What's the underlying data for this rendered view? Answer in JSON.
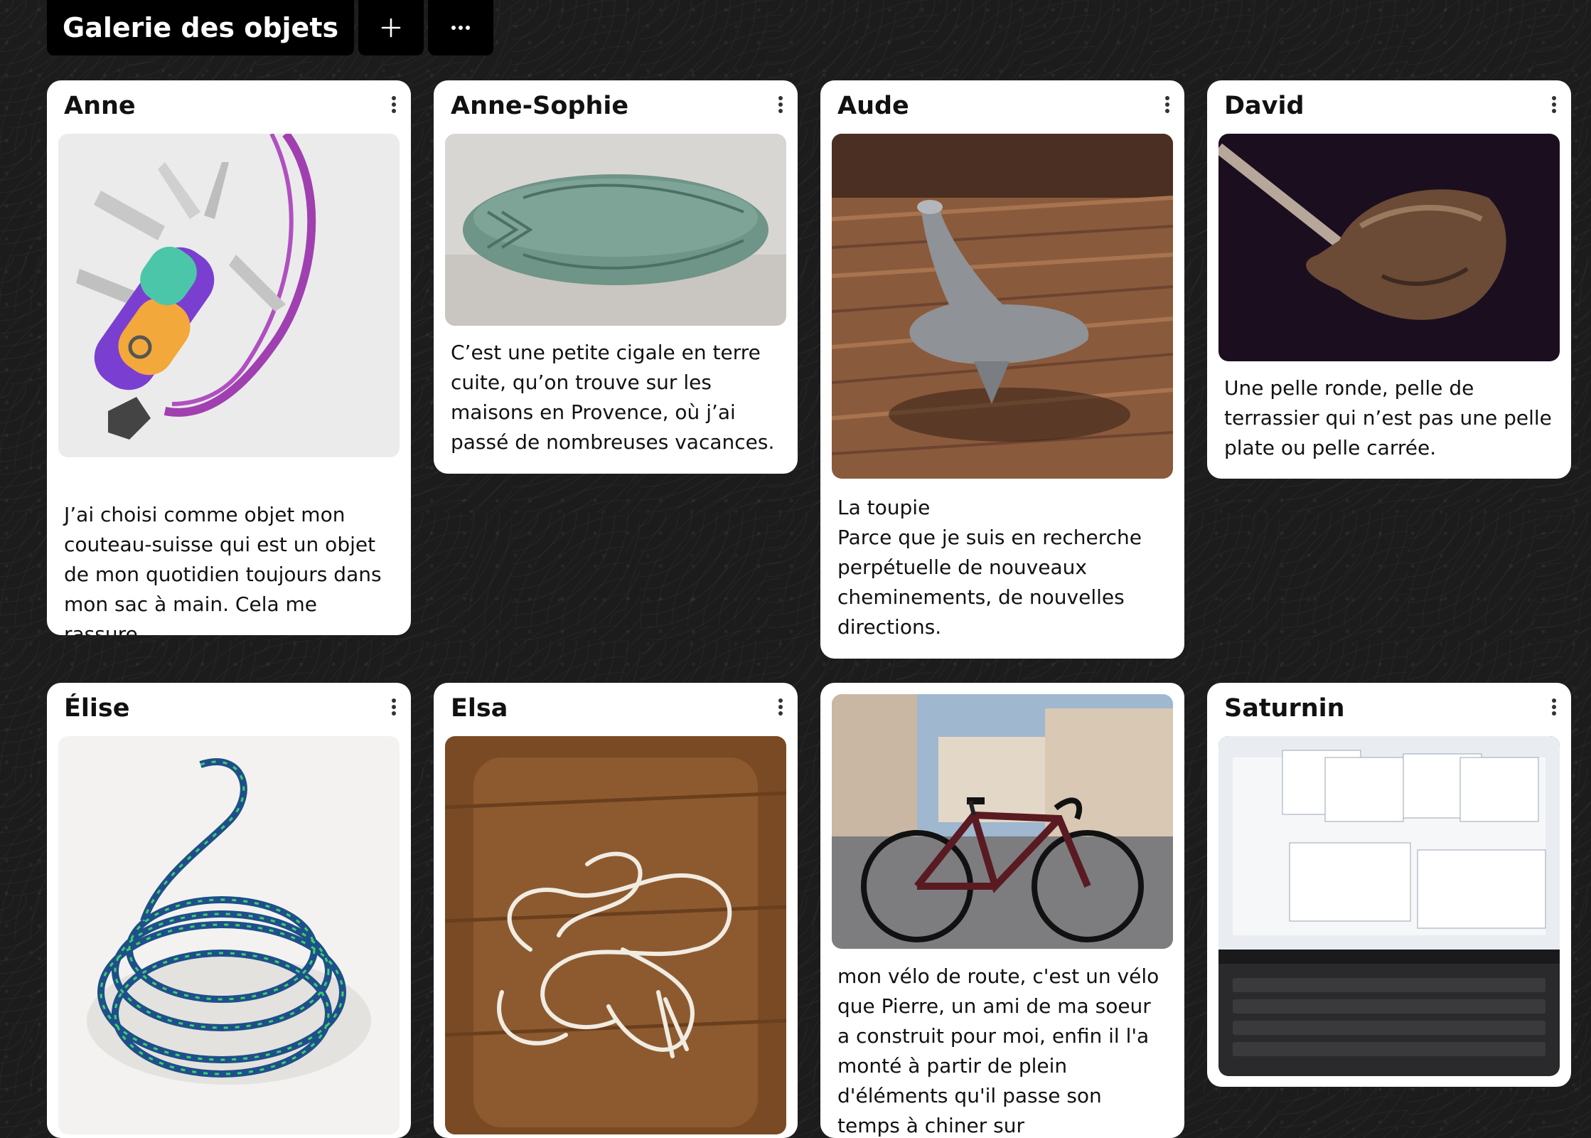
{
  "app": {
    "title": "Galerie des objets",
    "add_label": "+",
    "more_label": "···"
  },
  "cards": [
    {
      "author": "Anne",
      "description": "J’ai choisi comme objet mon couteau-suisse qui est un objet de mon quotidien toujours dans mon sac à main. Cela me rassure.",
      "image": "swiss-army-knife-photo"
    },
    {
      "author": "Anne-Sophie",
      "description": "C’est une petite cigale en terre cuite, qu’on trouve sur les maisons en Provence, où j’ai passé de nombreuses vacances.",
      "image": "ceramic-cicada-photo"
    },
    {
      "author": "Aude",
      "description": "La toupie\nParce que je suis en recherche perpétuelle de nouveaux cheminements, de nouvelles directions.",
      "image": "spinning-top-photo"
    },
    {
      "author": "David",
      "description": "Une pelle ronde, pelle de terrassier qui n’est pas une pelle plate ou pelle carrée.",
      "image": "round-shovel-photo"
    },
    {
      "author": "Élise",
      "description": "",
      "image": "rope-coil-photo"
    },
    {
      "author": "Elsa",
      "description": "",
      "image": "tangled-string-photo"
    },
    {
      "author": "",
      "description": "mon vélo de route, c'est un vélo que Pierre, un ami de ma soeur a construit pour moi, enfin il l'a monté à partir de plein d'éléments qu'il passe son temps à chiner sur",
      "image": "road-bike-photo"
    },
    {
      "author": "Saturnin",
      "description": "",
      "image": "laptop-screen-photo"
    }
  ],
  "colors": {
    "background": "#1c1c1c",
    "card": "#ffffff",
    "header": "#000000"
  }
}
